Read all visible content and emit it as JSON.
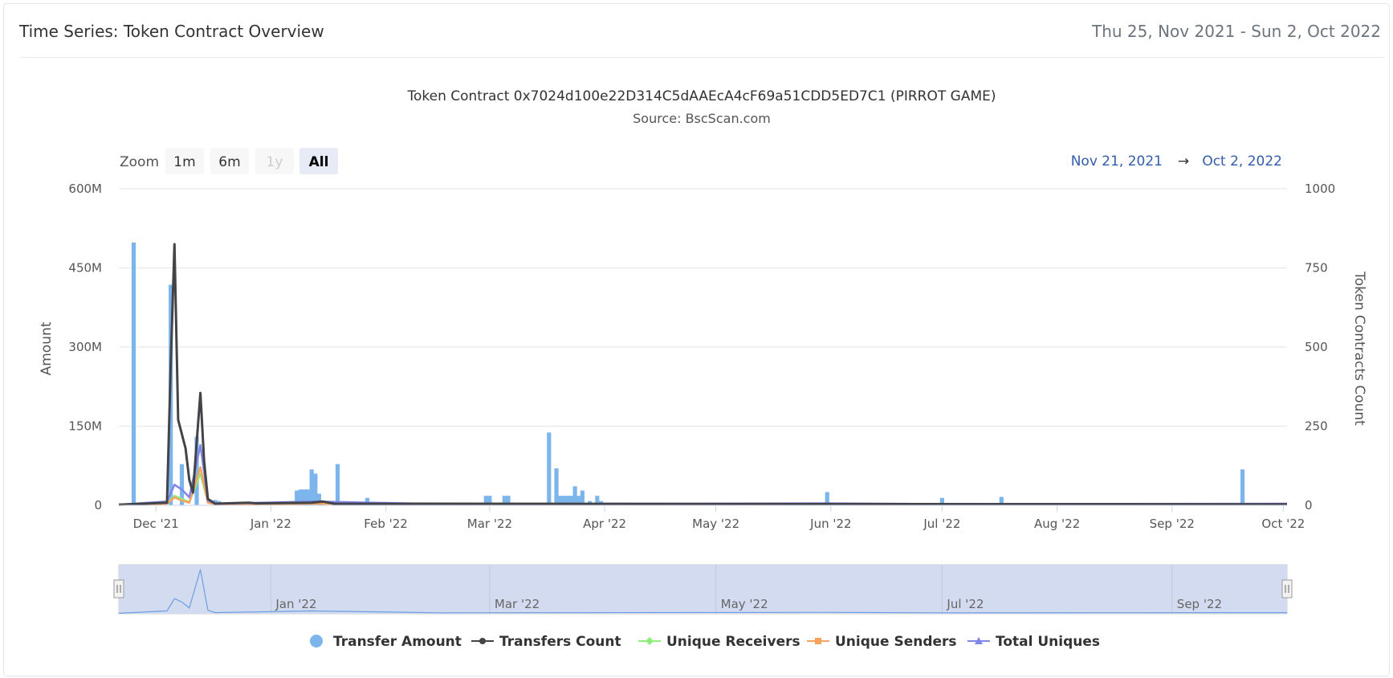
{
  "card": {
    "title": "Time Series: Token Contract Overview",
    "date_range": "Thu 25, Nov 2021 - Sun 2, Oct 2022"
  },
  "zoom": {
    "label": "Zoom",
    "buttons": [
      {
        "label": "1m",
        "state": "normal"
      },
      {
        "label": "6m",
        "state": "normal"
      },
      {
        "label": "1y",
        "state": "disabled"
      },
      {
        "label": "All",
        "state": "selected"
      }
    ]
  },
  "range_selector": {
    "from": "Nov 21, 2021",
    "arrow": "→",
    "to": "Oct 2, 2022"
  },
  "navigator": {
    "ticks": [
      "Jan '22",
      "Mar '22",
      "May '22",
      "Jul '22",
      "Sep '22"
    ]
  },
  "chart_data": {
    "type": "bar",
    "title": "Token Contract 0x7024d100e22D314C5dAAEcA4cF69a51CDD5ED7C1 (PIRROT GAME)",
    "subtitle": "Source: BscScan.com",
    "x_axis": {
      "range": [
        "2021-11-21",
        "2022-10-02"
      ],
      "tick_labels": [
        "Dec '21",
        "Jan '22",
        "Feb '22",
        "Mar '22",
        "Apr '22",
        "May '22",
        "Jun '22",
        "Jul '22",
        "Aug '22",
        "Sep '22",
        "Oct '22"
      ]
    },
    "y_axis_left": {
      "title": "Amount",
      "range": [
        0,
        600000000
      ],
      "tick_labels": [
        "0",
        "150M",
        "300M",
        "450M",
        "600M"
      ]
    },
    "y_axis_right": {
      "title": "Token Contracts Count",
      "range": [
        0,
        1000
      ],
      "tick_labels": [
        "0",
        "250",
        "500",
        "750",
        "1000"
      ]
    },
    "grid": true,
    "legend_position": "bottom",
    "series": [
      {
        "name": "Transfer Amount",
        "kind": "column",
        "axis": "left",
        "color": "#7cb5ec",
        "points": [
          [
            "2021-11-25",
            498000000
          ],
          [
            "2021-12-05",
            418000000
          ],
          [
            "2021-12-08",
            78000000
          ],
          [
            "2021-12-12",
            130000000
          ],
          [
            "2021-12-17",
            10000000
          ],
          [
            "2021-12-18",
            8000000
          ],
          [
            "2021-12-22",
            5000000
          ],
          [
            "2022-01-08",
            28000000
          ],
          [
            "2022-01-09",
            30000000
          ],
          [
            "2022-01-10",
            30000000
          ],
          [
            "2022-01-11",
            30000000
          ],
          [
            "2022-01-12",
            68000000
          ],
          [
            "2022-01-13",
            60000000
          ],
          [
            "2022-01-14",
            22000000
          ],
          [
            "2022-01-15",
            8000000
          ],
          [
            "2022-01-19",
            78000000
          ],
          [
            "2022-01-27",
            14000000
          ],
          [
            "2022-02-28",
            18000000
          ],
          [
            "2022-03-01",
            18000000
          ],
          [
            "2022-03-05",
            18000000
          ],
          [
            "2022-03-06",
            18000000
          ],
          [
            "2022-03-17",
            138000000
          ],
          [
            "2022-03-19",
            70000000
          ],
          [
            "2022-03-20",
            18000000
          ],
          [
            "2022-03-21",
            18000000
          ],
          [
            "2022-03-22",
            18000000
          ],
          [
            "2022-03-23",
            18000000
          ],
          [
            "2022-03-24",
            36000000
          ],
          [
            "2022-03-25",
            18000000
          ],
          [
            "2022-03-26",
            28000000
          ],
          [
            "2022-03-28",
            8000000
          ],
          [
            "2022-03-30",
            18000000
          ],
          [
            "2022-03-31",
            8000000
          ],
          [
            "2022-05-31",
            25000000
          ],
          [
            "2022-07-01",
            14000000
          ],
          [
            "2022-07-17",
            16000000
          ],
          [
            "2022-09-20",
            68000000
          ]
        ]
      },
      {
        "name": "Transfers Count",
        "kind": "line",
        "axis": "right",
        "color": "#434348",
        "points": [
          [
            "2021-11-21",
            2
          ],
          [
            "2021-12-04",
            8
          ],
          [
            "2021-12-05",
            450
          ],
          [
            "2021-12-06",
            825
          ],
          [
            "2021-12-07",
            270
          ],
          [
            "2021-12-09",
            180
          ],
          [
            "2021-12-10",
            80
          ],
          [
            "2021-12-11",
            40
          ],
          [
            "2021-12-12",
            200
          ],
          [
            "2021-12-13",
            355
          ],
          [
            "2021-12-14",
            140
          ],
          [
            "2021-12-15",
            20
          ],
          [
            "2021-12-17",
            5
          ],
          [
            "2021-12-26",
            8
          ],
          [
            "2021-12-28",
            6
          ],
          [
            "2022-01-12",
            8
          ],
          [
            "2022-01-15",
            12
          ],
          [
            "2022-01-18",
            5
          ],
          [
            "2022-10-02",
            3
          ]
        ]
      },
      {
        "name": "Unique Receivers",
        "kind": "line",
        "axis": "right",
        "color": "#90ed7d",
        "points": [
          [
            "2021-11-21",
            1
          ],
          [
            "2021-12-04",
            6
          ],
          [
            "2021-12-06",
            30
          ],
          [
            "2021-12-08",
            20
          ],
          [
            "2021-12-10",
            10
          ],
          [
            "2021-12-13",
            100
          ],
          [
            "2021-12-15",
            10
          ],
          [
            "2021-12-17",
            3
          ],
          [
            "2022-01-12",
            6
          ],
          [
            "2022-10-02",
            2
          ]
        ]
      },
      {
        "name": "Unique Senders",
        "kind": "line",
        "axis": "right",
        "color": "#f7a35c",
        "points": [
          [
            "2021-11-21",
            1
          ],
          [
            "2021-12-04",
            5
          ],
          [
            "2021-12-06",
            25
          ],
          [
            "2021-12-08",
            15
          ],
          [
            "2021-12-10",
            8
          ],
          [
            "2021-12-13",
            120
          ],
          [
            "2021-12-15",
            8
          ],
          [
            "2021-12-17",
            3
          ],
          [
            "2022-01-12",
            5
          ],
          [
            "2022-10-02",
            2
          ]
        ]
      },
      {
        "name": "Total Uniques",
        "kind": "line",
        "axis": "right",
        "color": "#8085e9",
        "points": [
          [
            "2021-11-21",
            2
          ],
          [
            "2021-12-04",
            12
          ],
          [
            "2021-12-06",
            65
          ],
          [
            "2021-12-08",
            50
          ],
          [
            "2021-12-10",
            25
          ],
          [
            "2021-12-13",
            190
          ],
          [
            "2021-12-15",
            15
          ],
          [
            "2021-12-17",
            5
          ],
          [
            "2022-01-12",
            12
          ],
          [
            "2022-02-15",
            4
          ],
          [
            "2022-05-31",
            6
          ],
          [
            "2022-07-01",
            4
          ],
          [
            "2022-10-02",
            5
          ]
        ]
      }
    ]
  }
}
